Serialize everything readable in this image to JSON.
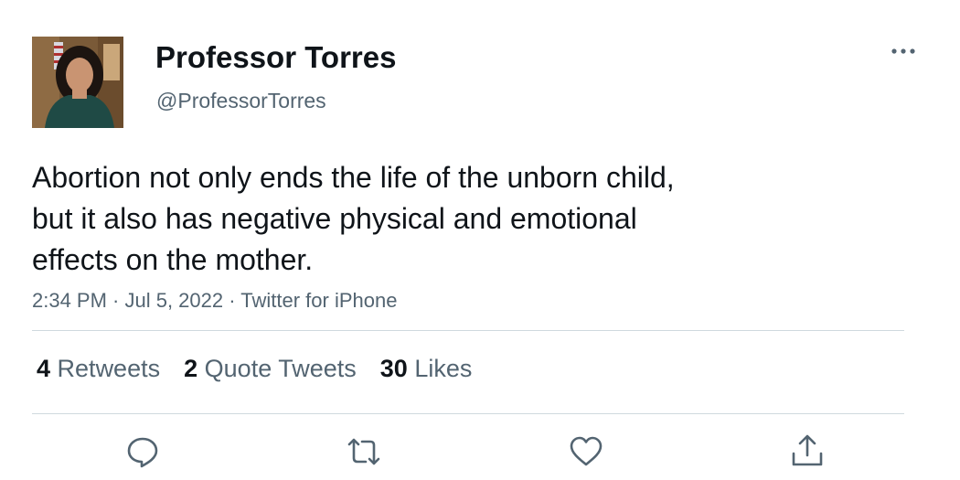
{
  "author": {
    "display_name": "Professor Torres",
    "handle": "@ProfessorTorres",
    "avatar_icon": "profile-photo"
  },
  "more_icon": "ellipsis-icon",
  "tweet": {
    "lines": [
      "Abortion not only ends the life of the unborn child,",
      "but it also has negative physical and emotional",
      "effects on the mother."
    ],
    "meta": "2:34 PM · Jul 5, 2022 · Twitter for iPhone"
  },
  "stats": {
    "retweets": {
      "count": "4",
      "label": "Retweets"
    },
    "quotes": {
      "count": "2",
      "label": "Quote Tweets"
    },
    "likes": {
      "count": "30",
      "label": "Likes"
    }
  },
  "actions": [
    "reply-icon",
    "retweet-icon",
    "like-icon",
    "share-icon"
  ],
  "colors": {
    "text": "#0f1419",
    "secondary": "#536471",
    "divider": "#cfd9de",
    "icon": "#536471"
  }
}
